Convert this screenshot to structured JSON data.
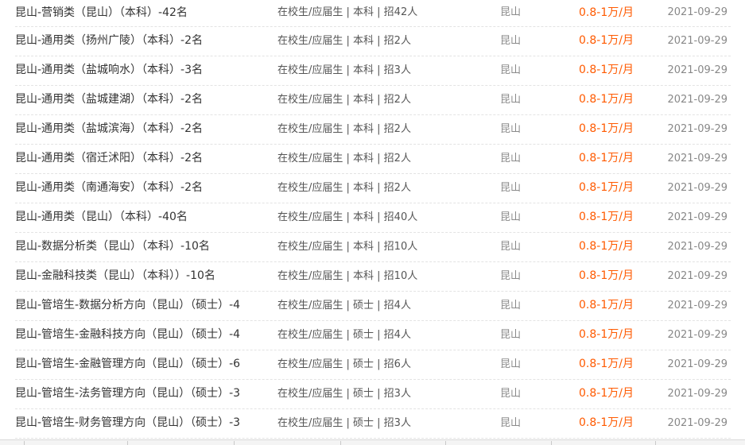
{
  "jobs": [
    {
      "title": "昆山-营销类（昆山）（本科）-42名",
      "req": "在校生/应届生 | 本科 | 招42人",
      "city": "昆山",
      "salary": "0.8-1万/月",
      "date": "2021-09-29"
    },
    {
      "title": "昆山-通用类（扬州广陵）（本科）-2名",
      "req": "在校生/应届生 | 本科 | 招2人",
      "city": "昆山",
      "salary": "0.8-1万/月",
      "date": "2021-09-29"
    },
    {
      "title": "昆山-通用类（盐城响水）（本科）-3名",
      "req": "在校生/应届生 | 本科 | 招3人",
      "city": "昆山",
      "salary": "0.8-1万/月",
      "date": "2021-09-29"
    },
    {
      "title": "昆山-通用类（盐城建湖）（本科）-2名",
      "req": "在校生/应届生 | 本科 | 招2人",
      "city": "昆山",
      "salary": "0.8-1万/月",
      "date": "2021-09-29"
    },
    {
      "title": "昆山-通用类（盐城滨海）（本科）-2名",
      "req": "在校生/应届生 | 本科 | 招2人",
      "city": "昆山",
      "salary": "0.8-1万/月",
      "date": "2021-09-29"
    },
    {
      "title": "昆山-通用类（宿迁沭阳）（本科）-2名",
      "req": "在校生/应届生 | 本科 | 招2人",
      "city": "昆山",
      "salary": "0.8-1万/月",
      "date": "2021-09-29"
    },
    {
      "title": "昆山-通用类（南通海安）（本科）-2名",
      "req": "在校生/应届生 | 本科 | 招2人",
      "city": "昆山",
      "salary": "0.8-1万/月",
      "date": "2021-09-29"
    },
    {
      "title": "昆山-通用类（昆山）（本科）-40名",
      "req": "在校生/应届生 | 本科 | 招40人",
      "city": "昆山",
      "salary": "0.8-1万/月",
      "date": "2021-09-29"
    },
    {
      "title": "昆山-数据分析类（昆山）（本科）-10名",
      "req": "在校生/应届生 | 本科 | 招10人",
      "city": "昆山",
      "salary": "0.8-1万/月",
      "date": "2021-09-29"
    },
    {
      "title": "昆山-金融科技类（昆山）（本科））-10名",
      "req": "在校生/应届生 | 本科 | 招10人",
      "city": "昆山",
      "salary": "0.8-1万/月",
      "date": "2021-09-29"
    },
    {
      "title": "昆山-管培生-数据分析方向（昆山）（硕士）-4",
      "req": "在校生/应届生 | 硕士 | 招4人",
      "city": "昆山",
      "salary": "0.8-1万/月",
      "date": "2021-09-29"
    },
    {
      "title": "昆山-管培生-金融科技方向（昆山）（硕士）-4",
      "req": "在校生/应届生 | 硕士 | 招4人",
      "city": "昆山",
      "salary": "0.8-1万/月",
      "date": "2021-09-29"
    },
    {
      "title": "昆山-管培生-金融管理方向（昆山）（硕士）-6",
      "req": "在校生/应届生 | 硕士 | 招6人",
      "city": "昆山",
      "salary": "0.8-1万/月",
      "date": "2021-09-29"
    },
    {
      "title": "昆山-管培生-法务管理方向（昆山）（硕士）-3",
      "req": "在校生/应届生 | 硕士 | 招3人",
      "city": "昆山",
      "salary": "0.8-1万/月",
      "date": "2021-09-29"
    },
    {
      "title": "昆山-管培生-财务管理方向（昆山）（硕士）-3",
      "req": "在校生/应届生 | 硕士 | 招3人",
      "city": "昆山",
      "salary": "0.8-1万/月",
      "date": "2021-09-29"
    }
  ],
  "colors": {
    "salary": "#ff5a00",
    "title": "#333333",
    "meta": "#888888"
  }
}
